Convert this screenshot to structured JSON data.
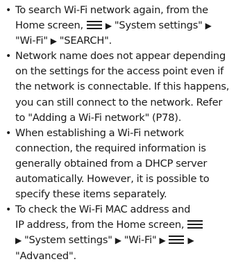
{
  "bullet_symbol": "•",
  "arrow": "▶",
  "items": [
    {
      "line1": "To search Wi-Fi network again, from the",
      "line2_pre": "Home screen, ",
      "line2_s1": "\"System settings\"",
      "line3_s1": "\"Wi-Fi\"",
      "line3_s2": "\"SEARCH\"."
    },
    {
      "lines": [
        "Network name does not appear depending",
        "on the settings for the access point even if",
        "the network is connectable. If this happens,",
        "you can still connect to the network. Refer",
        "to \"Adding a Wi-Fi network\" (P78)."
      ]
    },
    {
      "lines": [
        "When establishing a Wi-Fi network",
        "connection, the required information is",
        "generally obtained from a DHCP server",
        "automatically. However, it is possible to",
        "specify these items separately."
      ]
    },
    {
      "line1": "To check the Wi-Fi MAC address and",
      "line2_pre": "IP address, from the Home screen, ",
      "line3_s1": "\"System settings\"",
      "line3_s2": "\"Wi-Fi\"",
      "line4": "\"Advanced\"."
    }
  ]
}
